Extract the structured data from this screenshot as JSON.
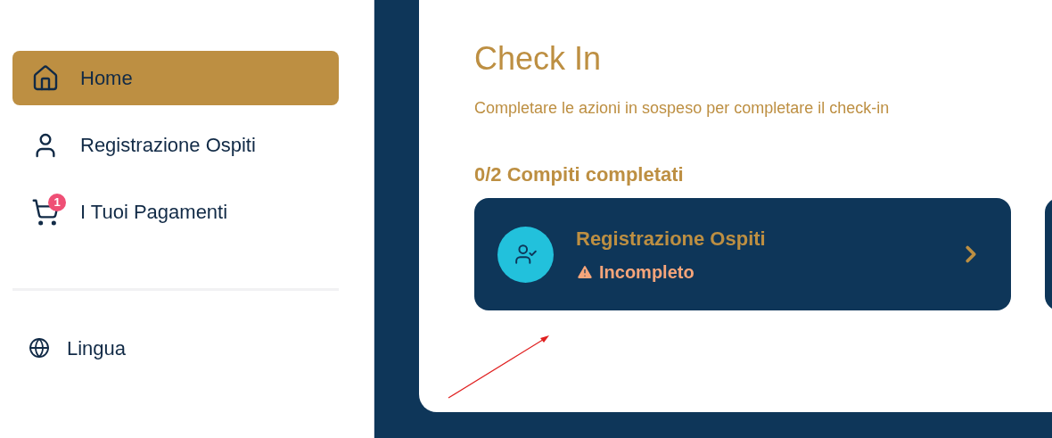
{
  "sidebar": {
    "items": [
      {
        "label": "Home",
        "selected": true
      },
      {
        "label": "Registrazione Ospiti",
        "selected": false
      },
      {
        "label": "I Tuoi Pagamenti",
        "selected": false,
        "badge": "1"
      }
    ],
    "footer_items": [
      {
        "label": "Lingua"
      }
    ]
  },
  "main": {
    "title": "Check In",
    "subtitle": "Completare le azioni in sospeso per completare il check-in",
    "progress": "0/2 Compiti completati",
    "tasks": [
      {
        "title": "Registrazione Ospiti",
        "status": "Incompleto",
        "kind": "incomplete"
      }
    ]
  }
}
